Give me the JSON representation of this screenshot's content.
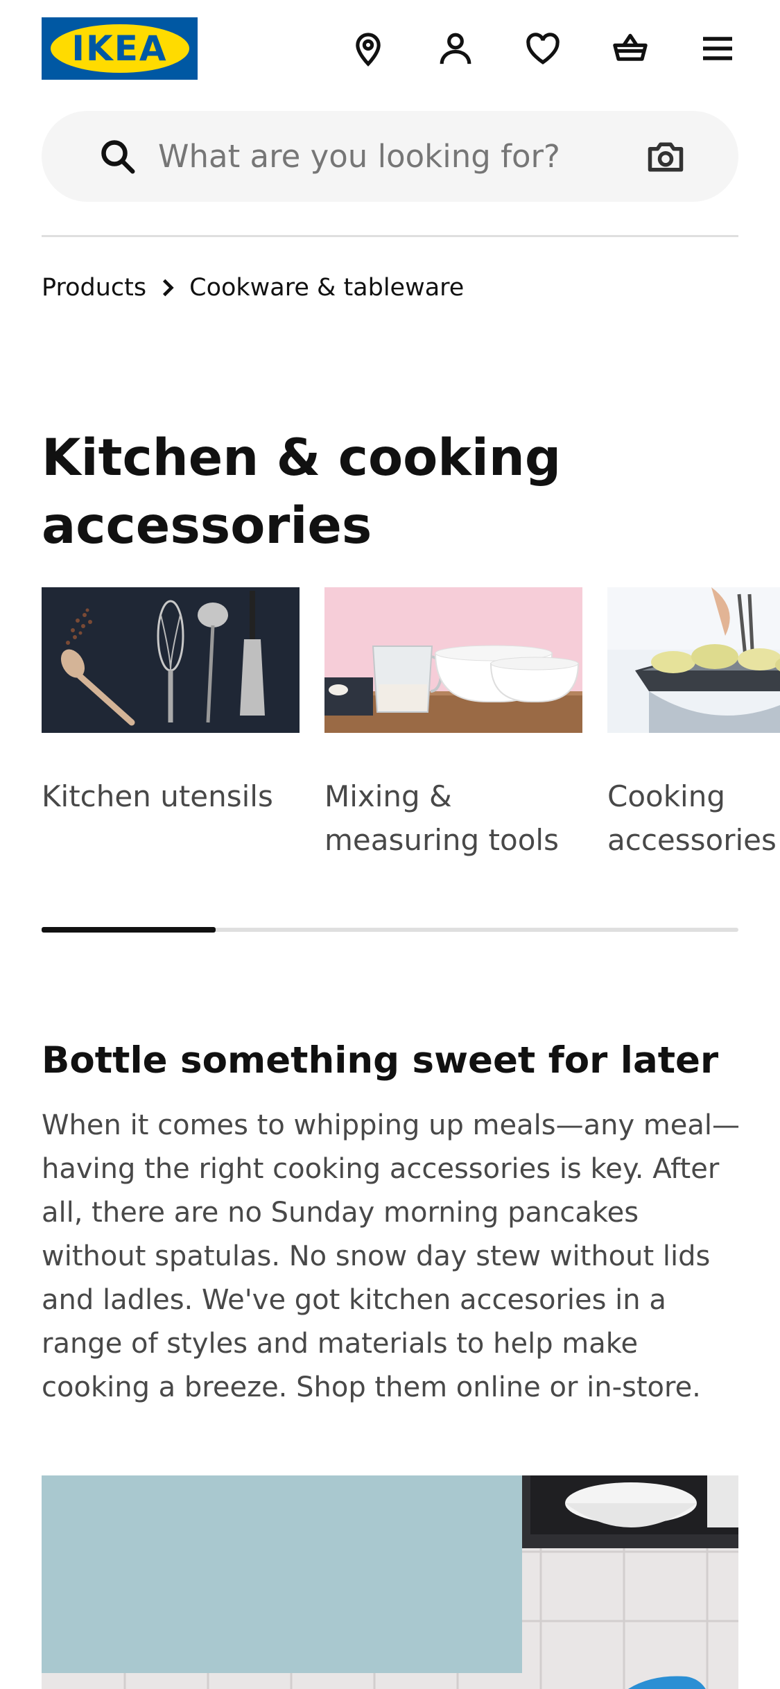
{
  "header": {
    "logo_text": "IKEA",
    "icons": [
      "location-icon",
      "account-icon",
      "heart-icon",
      "basket-icon",
      "menu-icon"
    ]
  },
  "search": {
    "placeholder": "What are you looking for?"
  },
  "breadcrumb": {
    "items": [
      "Products",
      "Cookware & tableware"
    ]
  },
  "page": {
    "title": "Kitchen & cooking accessories"
  },
  "categories": [
    {
      "label": "Kitchen utensils"
    },
    {
      "label": "Mixing & measuring tools"
    },
    {
      "label": "Cooking accessories"
    }
  ],
  "carousel": {
    "progress": 0.25
  },
  "content": {
    "heading": "Bottle something sweet for later",
    "body": "When it comes to whipping up meals—any meal—having the right cooking accessories is key. After all, there are no Sunday morning pancakes without spatulas. No snow day stew without lids and ladles. We've got kitchen accesories in a range of styles and materials to help make cooking a breeze. Shop them online or in-store."
  },
  "colors": {
    "brand_blue": "#0058a3",
    "brand_yellow": "#ffdb00",
    "text_primary": "#111111",
    "text_secondary": "#484848",
    "search_bg": "#f5f5f5"
  }
}
